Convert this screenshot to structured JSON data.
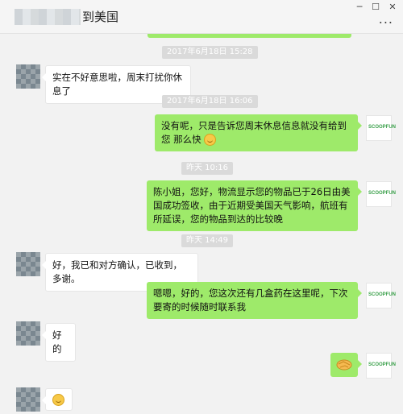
{
  "window": {
    "title": "到美国",
    "controls": {
      "minimize": "─",
      "maximize": "☐",
      "close": "✕",
      "more": "..."
    }
  },
  "brand_avatar": {
    "label": "SCOOPFUN"
  },
  "messages": [
    {
      "type": "timestamp",
      "text": "2017年6月18日 15:28"
    },
    {
      "type": "left",
      "text": "实在不好意思啦，周末打扰你休息了"
    },
    {
      "type": "timestamp",
      "text": "2017年6月18日 16:06"
    },
    {
      "type": "right",
      "text": "没有呢，只是告诉您周末休息信息就没有给到您 那么快"
    },
    {
      "type": "timestamp",
      "text": "昨天 10:16"
    },
    {
      "type": "right",
      "text": "陈小姐，您好，物流显示您的物品已于26日由美国成功签收，由于近期受美国天气影响，航班有所延误，您的物品到达的比较晚"
    },
    {
      "type": "timestamp",
      "text": "昨天 14:49"
    },
    {
      "type": "left",
      "text": "好，我已和对方确认，已收到，多谢。"
    },
    {
      "type": "right",
      "text": "嗯嗯，好的，您这次还有几盒药在这里呢，下次要寄的时候随时联系我"
    },
    {
      "type": "left",
      "text": "好的"
    },
    {
      "type": "right",
      "icon": "handshake-emoji"
    },
    {
      "type": "left",
      "icon": "smile-emoji"
    }
  ]
}
